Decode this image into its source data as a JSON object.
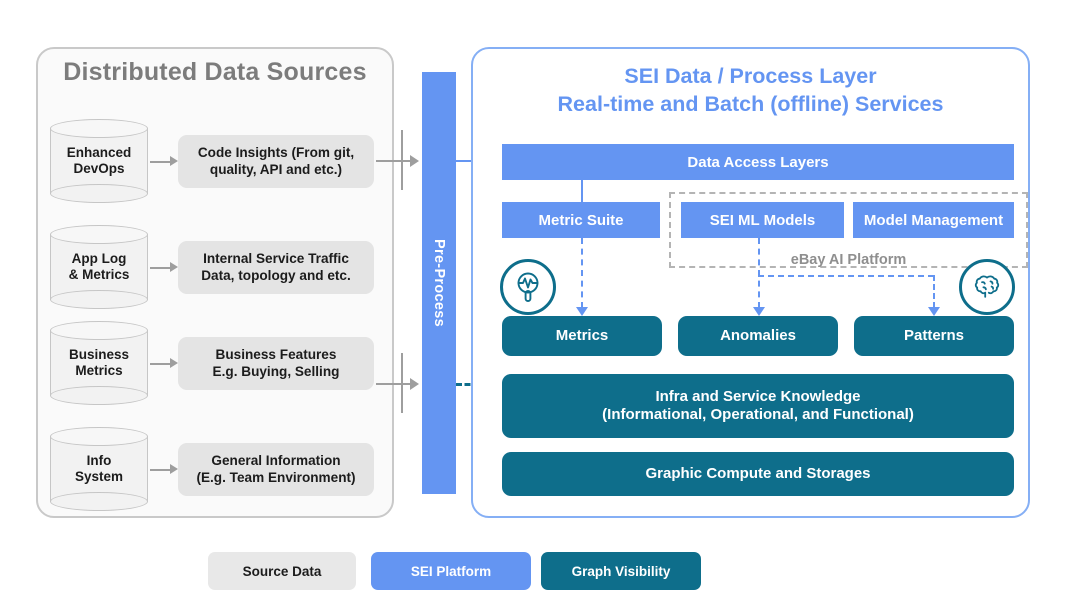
{
  "colors": {
    "blue": "#6495F2",
    "teal": "#0E6E8B",
    "grey_box": "#e4e4e4",
    "panel_border_blue": "#85AFF5",
    "panel_border_grey": "#c9c9c9",
    "title_grey": "#7c7c7c",
    "dash_grey": "#b4b4b4"
  },
  "left_panel": {
    "title": "Distributed Data Sources",
    "rows": [
      {
        "source": "Enhanced\nDevOps",
        "source_line1": "Enhanced",
        "source_line2": "DevOps",
        "detail_line1": "Code Insights (From git,",
        "detail_line2": "quality, API and etc.)"
      },
      {
        "source": "App Log\n& Metrics",
        "source_line1": "App Log",
        "source_line2": "& Metrics",
        "detail_line1": "Internal Service Traffic",
        "detail_line2": "Data, topology and etc."
      },
      {
        "source": "Business\nMetrics",
        "source_line1": "Business",
        "source_line2": "Metrics",
        "detail_line1": "Business Features",
        "detail_line2": "E.g. Buying, Selling"
      },
      {
        "source": "Info\nSystem",
        "source_line1": "Info",
        "source_line2": "System",
        "detail_line1": "General Information",
        "detail_line2": "(E.g. Team Environment)"
      }
    ]
  },
  "preprocess": {
    "label": "Pre-Process"
  },
  "right_panel": {
    "title_line1": "SEI Data / Process Layer",
    "title_line2": "Real-time and Batch (offline) Services",
    "data_access_layers": "Data Access Layers",
    "metric_suite": "Metric Suite",
    "sei_ml_models": "SEI ML Models",
    "model_management": "Model Management",
    "ebay_ai_platform": "eBay AI Platform",
    "outputs": [
      {
        "label": "Metrics"
      },
      {
        "label": "Anomalies"
      },
      {
        "label": "Patterns"
      }
    ],
    "infra_line1": "Infra and Service Knowledge",
    "infra_line2": "(Informational, Operational, and Functional)",
    "graphic_compute": "Graphic Compute and Storages",
    "icons": {
      "left": "magnifier-waveform-icon",
      "right": "brain-icon"
    }
  },
  "legend": [
    {
      "label": "Source Data",
      "bg": "#e8e8e8",
      "fg": "#1c1c1c"
    },
    {
      "label": "SEI Platform",
      "bg": "#6495F2",
      "fg": "#ffffff"
    },
    {
      "label": "Graph Visibility",
      "bg": "#0E6E8B",
      "fg": "#ffffff"
    }
  ]
}
